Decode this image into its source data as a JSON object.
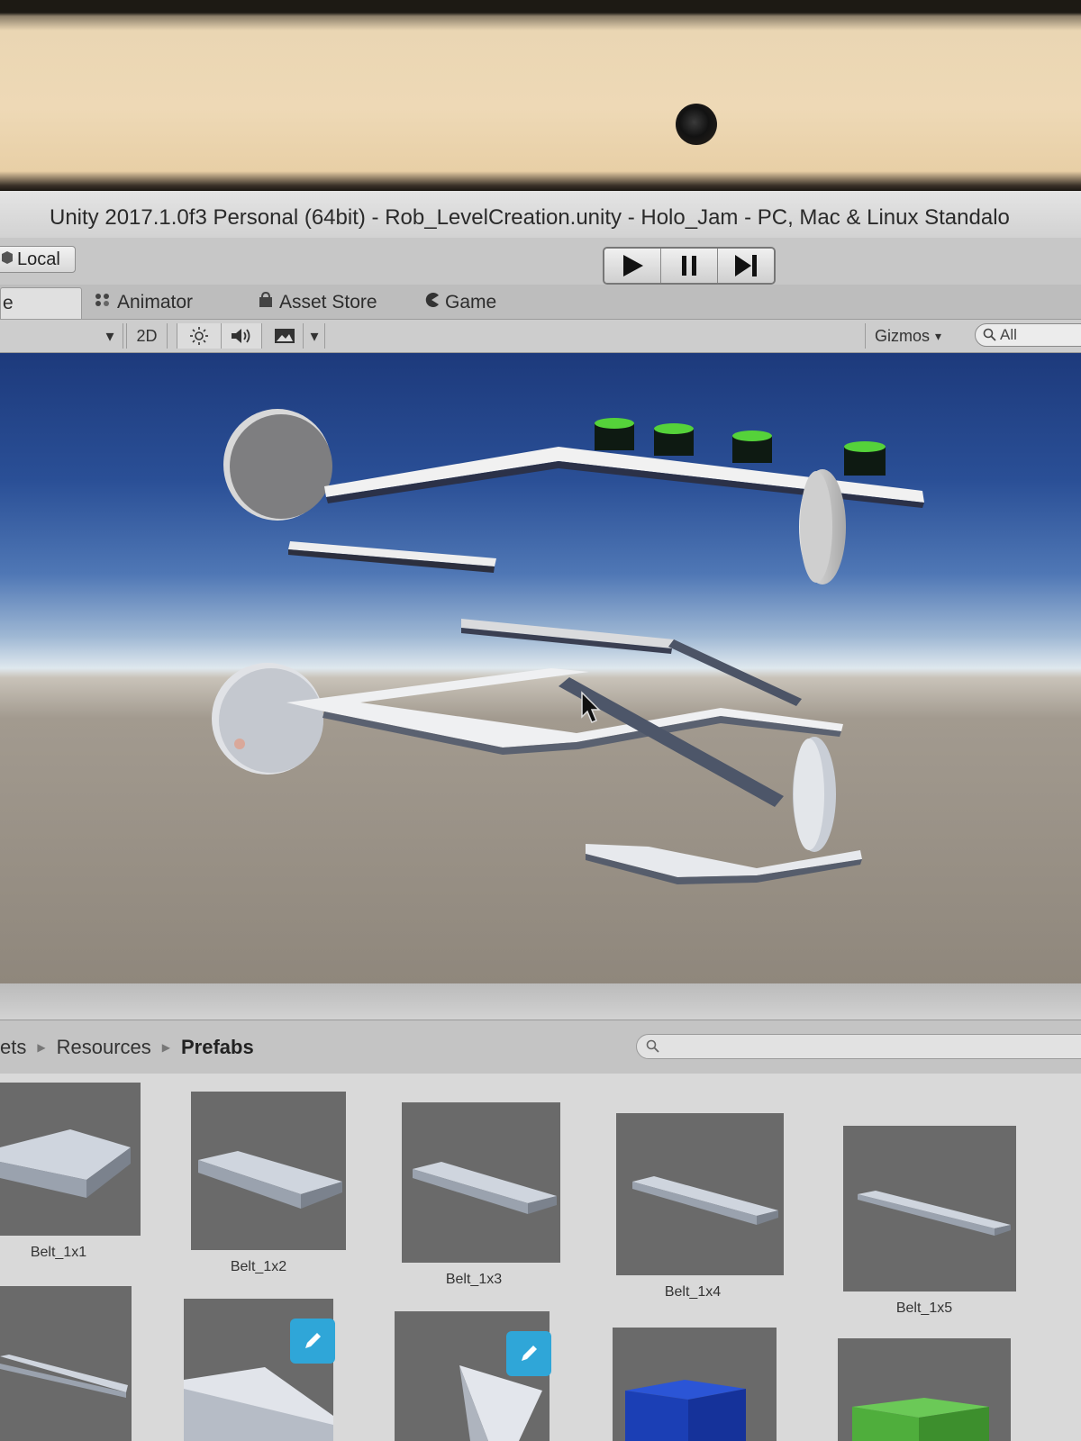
{
  "window": {
    "title": "Unity 2017.1.0f3 Personal (64bit) - Rob_LevelCreation.unity - Holo_Jam - PC, Mac & Linux Standalo"
  },
  "toolbar": {
    "local_label": "Local",
    "play_icon": "play-icon",
    "pause_icon": "pause-icon",
    "step_icon": "step-icon"
  },
  "tabs": [
    {
      "label": "e",
      "active": true
    },
    {
      "label": "Animator",
      "icon": "animator-icon"
    },
    {
      "label": "Asset Store",
      "icon": "bag-icon"
    },
    {
      "label": "Game",
      "icon": "pacman-icon"
    }
  ],
  "scene_toolbar": {
    "mode_2d": "2D",
    "gizmos_label": "Gizmos",
    "search_placeholder": "All"
  },
  "project": {
    "breadcrumb": [
      "ets",
      "Resources",
      "Prefabs"
    ],
    "items": [
      {
        "label": "Belt_1x1"
      },
      {
        "label": "Belt_1x2"
      },
      {
        "label": "Belt_1x3"
      },
      {
        "label": "Belt_1x4"
      },
      {
        "label": "Belt_1x5"
      },
      {
        "label": ""
      },
      {
        "label": ""
      },
      {
        "label": ""
      },
      {
        "label": ""
      },
      {
        "label": ""
      }
    ]
  },
  "colors": {
    "sky_top": "#1d3a7c",
    "ground": "#8f877c",
    "target_green": "#55d23a",
    "edit_badge": "#2fa6d8",
    "cube_blue": "#1b3fb5",
    "cube_green": "#4fae3c"
  }
}
